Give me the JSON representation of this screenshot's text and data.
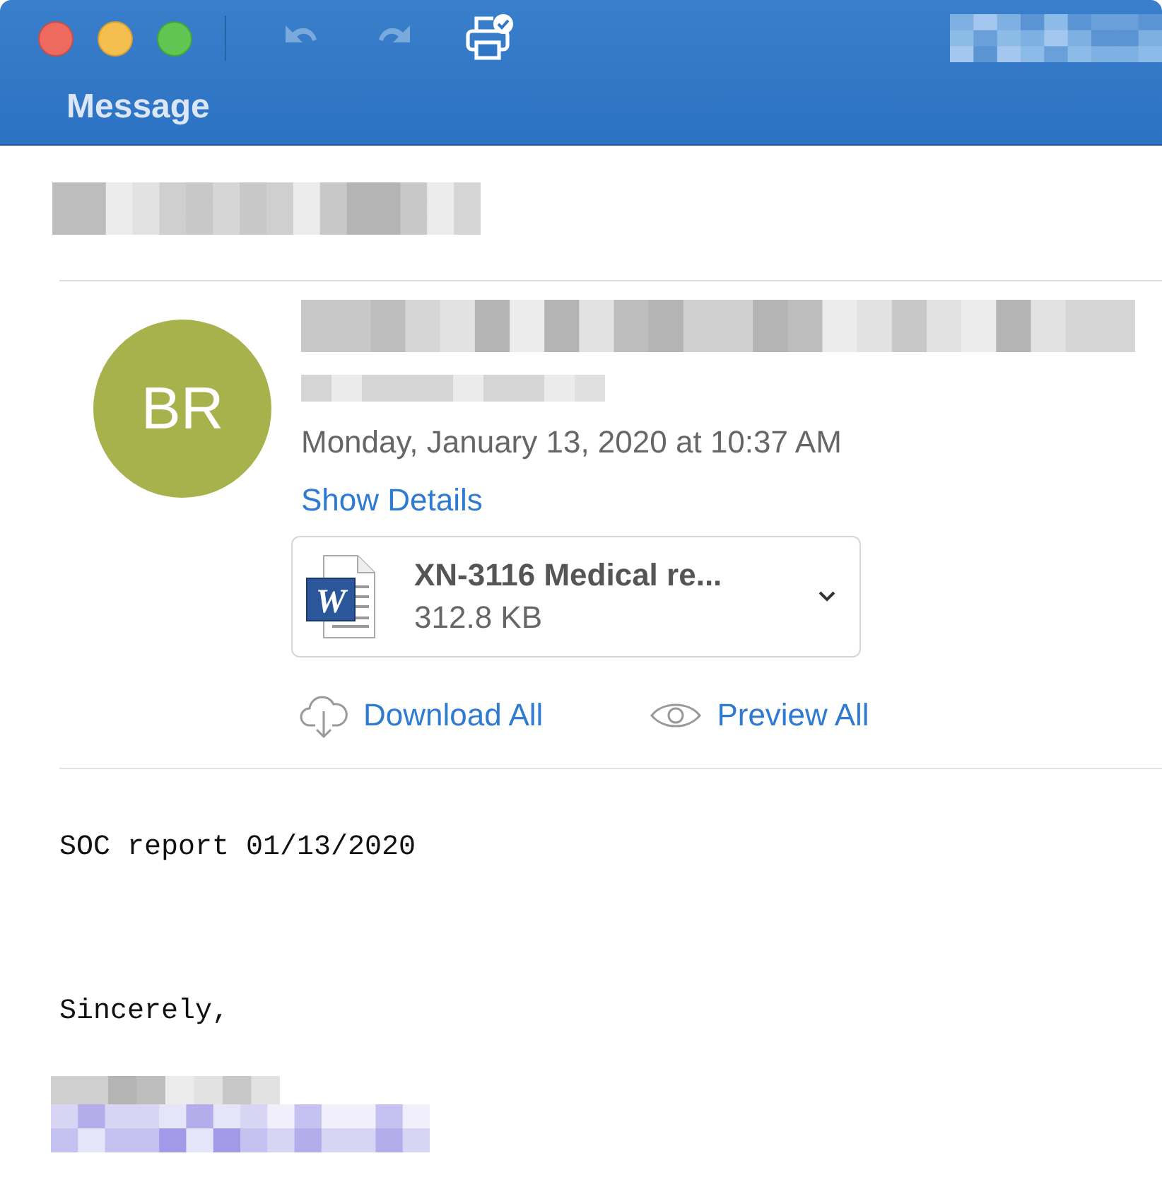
{
  "toolbar": {
    "title": "Message"
  },
  "message": {
    "avatar_initials": "BR",
    "date": "Monday, January 13, 2020 at 10:37 AM",
    "details_link": "Show Details"
  },
  "attachments": [
    {
      "kind": "word",
      "badge": "W",
      "name": "XN-3116 Medical re...",
      "size": "312.8 KB"
    }
  ],
  "attachment_actions": [
    {
      "kind": "download",
      "label": "Download All"
    },
    {
      "kind": "preview",
      "label": "Preview All"
    }
  ],
  "body": [
    "SOC report 01/13/2020",
    "Sincerely,"
  ]
}
